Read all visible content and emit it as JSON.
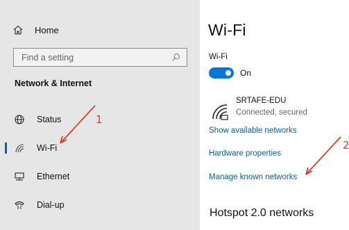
{
  "sidebar": {
    "home_label": "Home",
    "search_placeholder": "Find a setting",
    "section_title": "Network & Internet",
    "items": [
      {
        "label": "Status",
        "icon": "globe-icon"
      },
      {
        "label": "Wi-Fi",
        "icon": "wifi-icon",
        "active": true
      },
      {
        "label": "Ethernet",
        "icon": "ethernet-icon"
      },
      {
        "label": "Dial-up",
        "icon": "phone-icon"
      }
    ]
  },
  "main": {
    "title": "Wi-Fi",
    "wifi_label": "Wi-Fi",
    "toggle_state": "On",
    "network": {
      "name": "SRTAFE-EDU",
      "status": "Connected, secured"
    },
    "links": {
      "show_available": "Show available networks",
      "hardware_properties": "Hardware properties",
      "manage_known": "Manage known networks"
    },
    "hotspot_heading": "Hotspot 2.0 networks"
  },
  "annotations": {
    "arrow1": "1",
    "arrow2": "2"
  },
  "colors": {
    "accent": "#0078d7",
    "link": "#0063b1",
    "annotation": "#e23b2e",
    "sidebar_bg": "#e6e6e6"
  }
}
